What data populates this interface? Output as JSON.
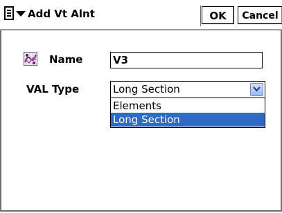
{
  "window": {
    "title": "Add Vt Alnt",
    "ok_label": "OK",
    "cancel_label": "Cancel"
  },
  "form": {
    "name_label": "Name",
    "name_value": "V3",
    "type_label": "VAL Type",
    "type_value": "Long Section",
    "type_options": [
      "Elements",
      "Long Section"
    ],
    "selected_option_index": 1
  },
  "colors": {
    "highlight": "#3169c6",
    "dropdown_button": "#9ab7ee"
  },
  "icons": {
    "menu": "menu-doc-icon",
    "dropdown": "chevron-down-icon",
    "name": "alignment-icon"
  }
}
